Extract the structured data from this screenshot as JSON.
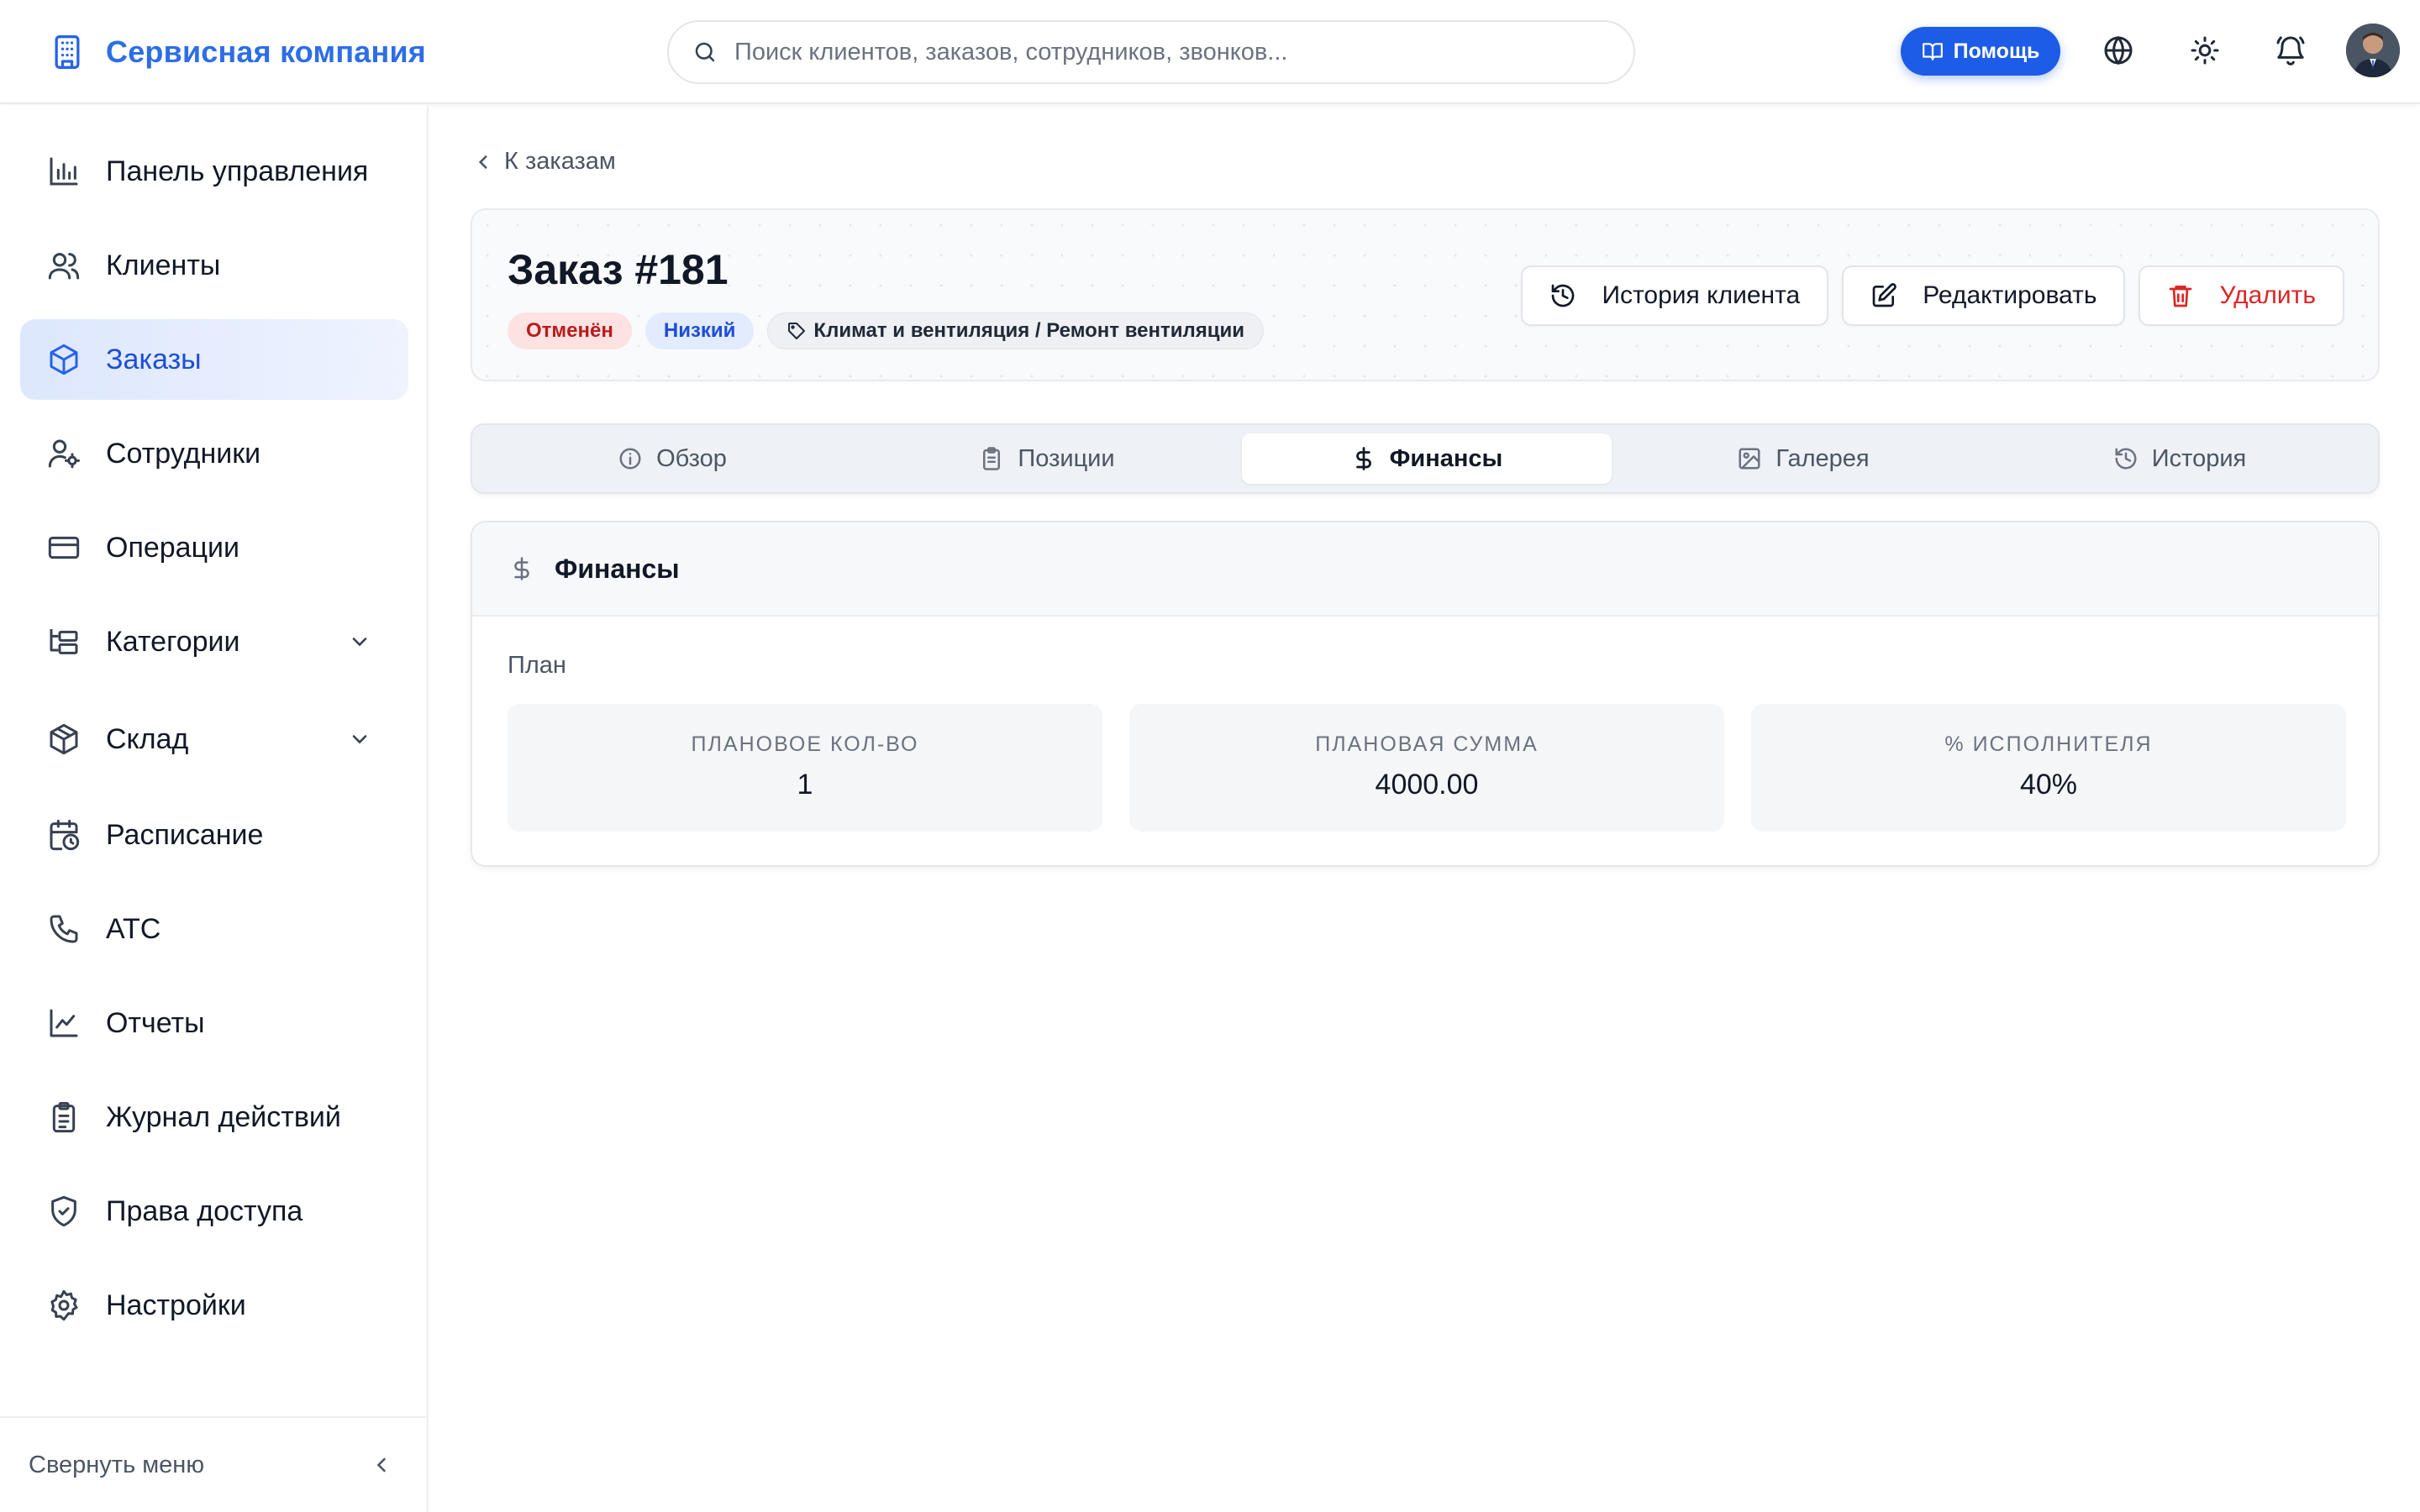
{
  "header": {
    "brand": "Сервисная компания",
    "search_placeholder": "Поиск клиентов, заказов, сотрудников, звонков...",
    "help_label": "Помощь",
    "icons": [
      "globe-icon",
      "sun-icon",
      "bell-icon"
    ]
  },
  "sidebar": {
    "items": [
      {
        "label": "Панель управления",
        "icon": "bar-chart-icon"
      },
      {
        "label": "Клиенты",
        "icon": "users-icon"
      },
      {
        "label": "Заказы",
        "icon": "box-icon",
        "active": true
      },
      {
        "label": "Сотрудники",
        "icon": "user-cog-icon"
      },
      {
        "label": "Операции",
        "icon": "credit-card-icon"
      },
      {
        "label": "Категории",
        "icon": "folder-tree-icon",
        "expandable": true
      },
      {
        "label": "Склад",
        "icon": "package-icon",
        "expandable": true
      },
      {
        "label": "Расписание",
        "icon": "calendar-clock-icon"
      },
      {
        "label": "АТС",
        "icon": "phone-icon"
      },
      {
        "label": "Отчеты",
        "icon": "line-chart-icon"
      },
      {
        "label": "Журнал действий",
        "icon": "clipboard-list-icon"
      },
      {
        "label": "Права доступа",
        "icon": "shield-check-icon"
      },
      {
        "label": "Настройки",
        "icon": "settings-icon"
      }
    ],
    "collapse_label": "Свернуть меню"
  },
  "main": {
    "back_label": "К заказам",
    "order_title": "Заказ #181",
    "badges": {
      "status": "Отменён",
      "priority": "Низкий",
      "category": "Климат и вентиляция / Ремонт вентиляции"
    },
    "actions": {
      "history": "История клиента",
      "edit": "Редактировать",
      "delete": "Удалить"
    },
    "tabs": [
      {
        "label": "Обзор",
        "icon": "info-icon"
      },
      {
        "label": "Позиции",
        "icon": "clipboard-icon"
      },
      {
        "label": "Финансы",
        "icon": "dollar-icon",
        "active": true
      },
      {
        "label": "Галерея",
        "icon": "image-icon"
      },
      {
        "label": "История",
        "icon": "history-icon"
      }
    ],
    "finance": {
      "title": "Финансы",
      "plan_label": "План",
      "stats": [
        {
          "label": "ПЛАНОВОЕ КОЛ-ВО",
          "value": "1"
        },
        {
          "label": "ПЛАНОВАЯ СУММА",
          "value": "4000.00"
        },
        {
          "label": "% ИСПОЛНИТЕЛЯ",
          "value": "40%"
        }
      ]
    }
  },
  "colors": {
    "accent": "#2563eb",
    "danger": "#dc2626",
    "active_nav_bg": "#e6edfd"
  }
}
